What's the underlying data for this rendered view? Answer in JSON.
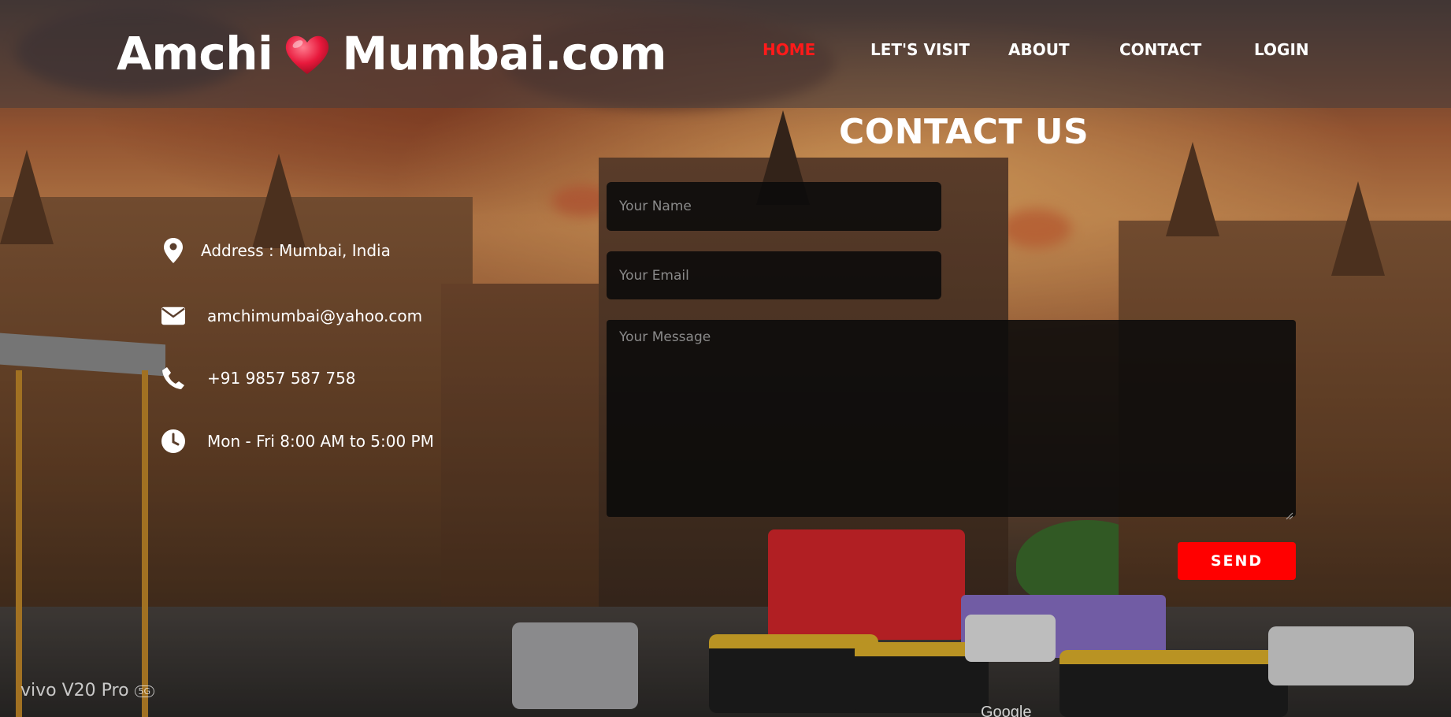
{
  "brand": {
    "name_left": "Amchi",
    "name_right": "Mumbai.com",
    "heart_color": "#e8193c"
  },
  "nav": {
    "items": [
      {
        "label": "HOME",
        "active": true
      },
      {
        "label": "LET'S VISIT",
        "active": false
      },
      {
        "label": "ABOUT",
        "active": false
      },
      {
        "label": "CONTACT",
        "active": false
      },
      {
        "label": "LOGIN",
        "active": false
      }
    ],
    "active_color": "#ff1a1a"
  },
  "contact": {
    "title": "CONTACT US",
    "info": {
      "address": "Address : Mumbai, India",
      "email": "amchimumbai@yahoo.com",
      "phone": "+91 9857 587 758",
      "hours": "Mon - Fri 8:00 AM to 5:00 PM"
    },
    "icons": {
      "address": "location-pin-icon",
      "email": "envelope-icon",
      "phone": "phone-icon",
      "hours": "clock-icon"
    },
    "form": {
      "name_placeholder": "Your Name",
      "email_placeholder": "Your Email",
      "message_placeholder": "Your Message",
      "send_label": "SEND",
      "send_color": "#ff0000"
    }
  },
  "watermarks": {
    "camera": "vivo V20 Pro",
    "camera_badge": "5G",
    "map": "Google"
  }
}
